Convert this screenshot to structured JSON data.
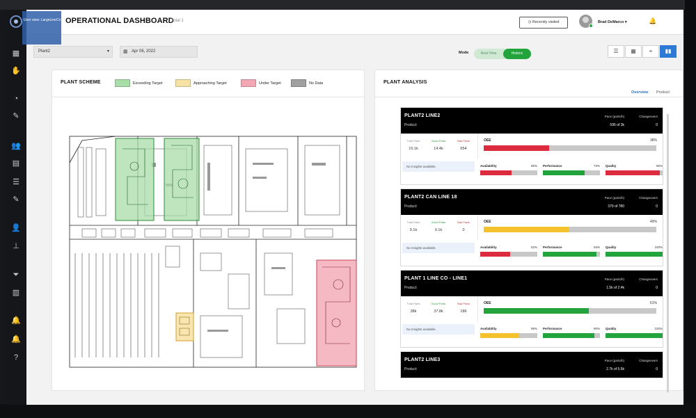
{
  "user_view": "User view: LargeLineCo",
  "header": {
    "title": "OPERATIONAL DASHBOARD",
    "subtitle": "Total 1",
    "recent_button": "Recently visited",
    "username": "Brad DeMarco ▾"
  },
  "toolbar": {
    "plant": "Plant2",
    "date": "Apr 06, 2022",
    "mode_label": "Mode",
    "mode_options": [
      "Real-Time",
      "Historic"
    ],
    "mode_selected": "Historic"
  },
  "plant_scheme": {
    "title": "PLANT SCHEME",
    "legend": [
      {
        "label": "Exceeding Target",
        "color": "#a8dca8"
      },
      {
        "label": "Approaching Target",
        "color": "#f7e2a6"
      },
      {
        "label": "Under Target",
        "color": "#f2a7b4"
      },
      {
        "label": "No Data",
        "color": "#a0a0a0"
      }
    ]
  },
  "plant_analysis": {
    "title": "PLANT ANALYSIS",
    "tabs": [
      "Overview",
      "Product"
    ],
    "pace_label": "Pace (parts/h)",
    "changeovers_label": "Changeovers",
    "part_labels": [
      "Total Parts",
      "Good Parts",
      "Bad Parts"
    ],
    "part_colors": [
      "#888888",
      "#2a9a3c",
      "#d0303c"
    ],
    "oee_label": "OEE",
    "metric_labels": [
      "Availability",
      "Performance",
      "Quality"
    ],
    "insights_text": "No Insights available.",
    "cards": [
      {
        "name": "PLANT2 LINE2",
        "product": "Product:",
        "pace": "595 of 3k",
        "changeovers": "0",
        "parts": [
          "15.1k",
          "14.4k",
          "654"
        ],
        "oee": {
          "pct": "38%",
          "value": 38,
          "color": "#dc2a3e"
        },
        "metrics": [
          {
            "pct": "55%",
            "value": 55,
            "color": "#dc2a3e"
          },
          {
            "pct": "73%",
            "value": 73,
            "color": "#22a33b"
          },
          {
            "pct": "95%",
            "value": 95,
            "color": "#dc2a3e"
          }
        ]
      },
      {
        "name": "PLANT2 CAN LINE 18",
        "product": "Product:",
        "pace": "379 of 780",
        "changeovers": "0",
        "parts": [
          "9.1k",
          "9.1k",
          "0"
        ],
        "oee": {
          "pct": "49%",
          "value": 49,
          "color": "#f3c22c"
        },
        "metrics": [
          {
            "pct": "52%",
            "value": 52,
            "color": "#dc2a3e"
          },
          {
            "pct": "94%",
            "value": 94,
            "color": "#22a33b"
          },
          {
            "pct": "100%",
            "value": 100,
            "color": "#22a33b"
          }
        ]
      },
      {
        "name": "PLANT 1 LINE CO - LINE1",
        "product": "Product:",
        "pace": "1.5k of 2.4k",
        "changeovers": "0",
        "parts": [
          "38k",
          "37.8k",
          "186"
        ],
        "oee": {
          "pct": "61%",
          "value": 61,
          "color": "#22a33b"
        },
        "metrics": [
          {
            "pct": "68%",
            "value": 68,
            "color": "#f3c22c"
          },
          {
            "pct": "90%",
            "value": 90,
            "color": "#22a33b"
          },
          {
            "pct": "100%",
            "value": 100,
            "color": "#22a33b"
          }
        ]
      },
      {
        "name": "PLANT2 LINE3",
        "product": "Product:",
        "pace": "2.7k of 5.5k",
        "changeovers": "0"
      }
    ]
  }
}
